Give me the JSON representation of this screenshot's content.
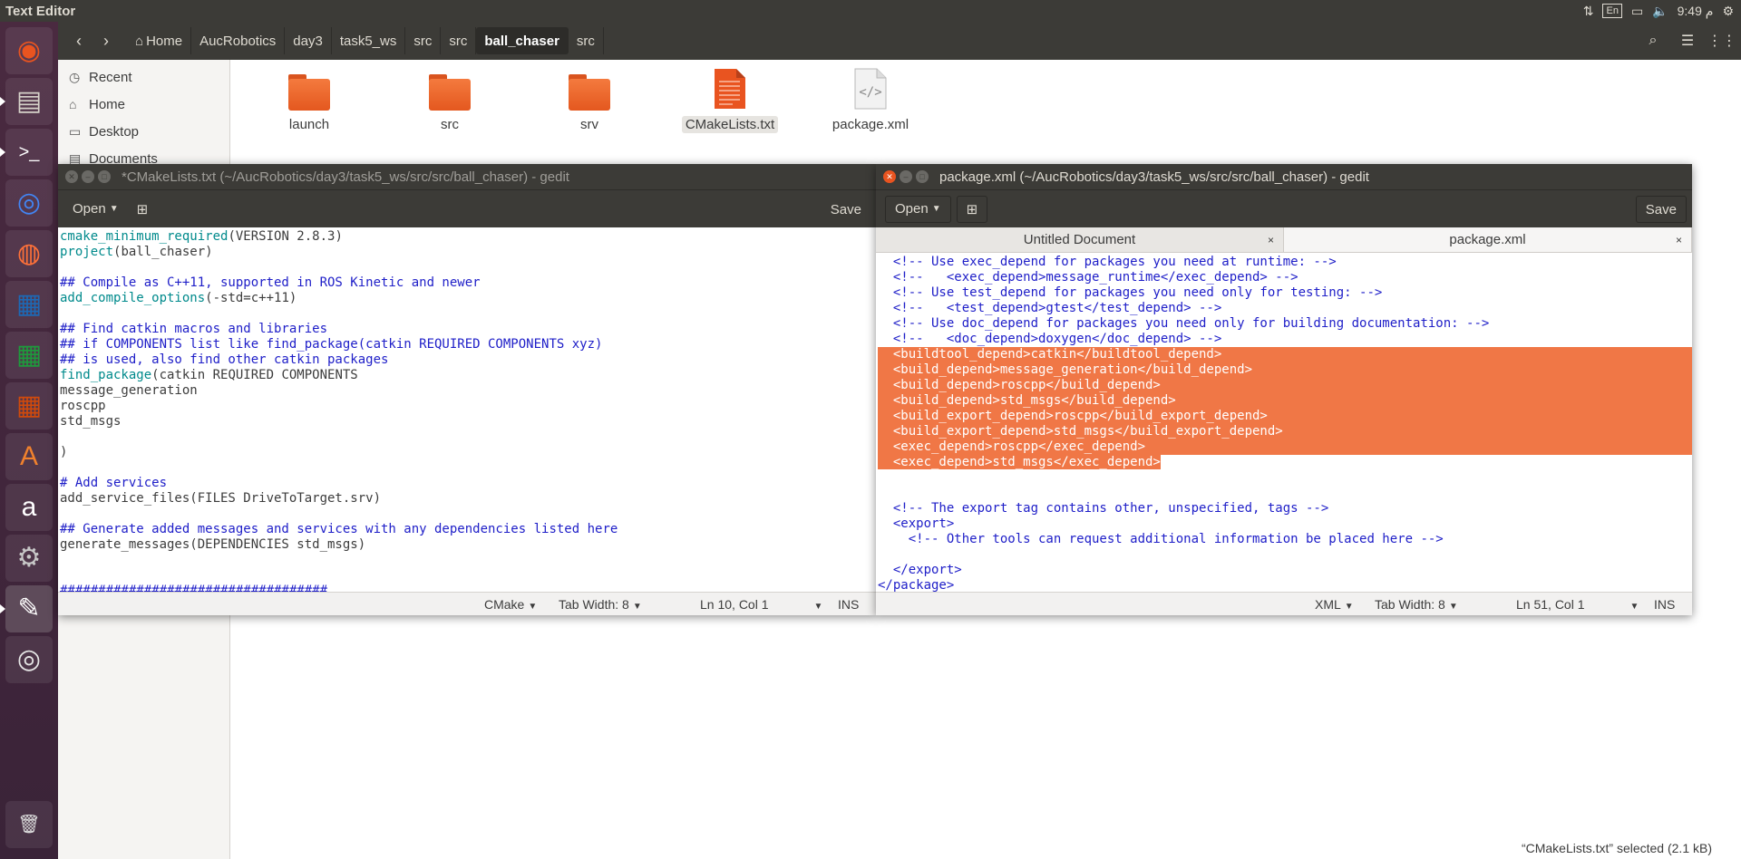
{
  "top_panel": {
    "app_title": "Text Editor",
    "keyboard_layout": "En",
    "clock": "9:49 م"
  },
  "launcher": {
    "items": [
      {
        "name": "ubuntu-logo-icon",
        "glyph": "◉",
        "color": "#e95420"
      },
      {
        "name": "files-icon",
        "glyph": "▤",
        "color": "#d6d2c9"
      },
      {
        "name": "terminal-icon",
        "glyph": ">_",
        "color": "#ffffff"
      },
      {
        "name": "chrome-icon",
        "glyph": "◎",
        "color": "#4285f4"
      },
      {
        "name": "firefox-icon",
        "glyph": "◍",
        "color": "#ff7139"
      },
      {
        "name": "writer-icon",
        "glyph": "▦",
        "color": "#1d69b5"
      },
      {
        "name": "calc-icon",
        "glyph": "▦",
        "color": "#1e9a3c"
      },
      {
        "name": "impress-icon",
        "glyph": "▦",
        "color": "#d04a0c"
      },
      {
        "name": "software-center-icon",
        "glyph": "A",
        "color": "#f0812d"
      },
      {
        "name": "amazon-icon",
        "glyph": "a",
        "color": "#ffffff"
      },
      {
        "name": "settings-icon",
        "glyph": "⚙",
        "color": "#c7c7c7"
      },
      {
        "name": "text-editor-icon",
        "glyph": "✎",
        "color": "#ffffff"
      },
      {
        "name": "dvd-icon",
        "glyph": "◎",
        "color": "#e6e6e6"
      },
      {
        "name": "trash-icon",
        "glyph": "🗑",
        "color": "#dddddd"
      }
    ]
  },
  "nautilus": {
    "breadcrumb": [
      {
        "label": "Home",
        "active": false
      },
      {
        "label": "AucRobotics",
        "active": false
      },
      {
        "label": "day3",
        "active": false
      },
      {
        "label": "task5_ws",
        "active": false
      },
      {
        "label": "src",
        "active": false
      },
      {
        "label": "src",
        "active": false
      },
      {
        "label": "ball_chaser",
        "active": true
      },
      {
        "label": "src",
        "active": false
      }
    ],
    "places": [
      "Recent",
      "Home",
      "Desktop",
      "Documents"
    ],
    "files": [
      {
        "label": "launch",
        "type": "folder",
        "selected": false
      },
      {
        "label": "src",
        "type": "folder",
        "selected": false
      },
      {
        "label": "srv",
        "type": "folder",
        "selected": false
      },
      {
        "label": "CMakeLists.txt",
        "type": "text",
        "selected": true
      },
      {
        "label": "package.xml",
        "type": "xml",
        "selected": false
      }
    ],
    "status": "“CMakeLists.txt” selected  (2.1 kB)"
  },
  "gedit_left": {
    "title": "*CMakeLists.txt (~/AucRobotics/day3/task5_ws/src/src/ball_chaser) - gedit",
    "open_label": "Open",
    "save_label": "Save",
    "lines": [
      [
        {
          "t": "cmake_minimum_required",
          "c": "kw"
        },
        {
          "t": "(VERSION 2.8.3)",
          "c": ""
        }
      ],
      [
        {
          "t": "project",
          "c": "kw"
        },
        {
          "t": "(ball_chaser)",
          "c": ""
        }
      ],
      [],
      [
        {
          "t": "## Compile as C++11, supported in ROS Kinetic and newer",
          "c": "cm"
        }
      ],
      [
        {
          "t": "add_compile_options",
          "c": "kw"
        },
        {
          "t": "(-std=c++11)",
          "c": ""
        }
      ],
      [],
      [
        {
          "t": "## Find catkin macros and libraries",
          "c": "cm"
        }
      ],
      [
        {
          "t": "## if COMPONENTS list like find_package(catkin REQUIRED COMPONENTS xyz)",
          "c": "cm"
        }
      ],
      [
        {
          "t": "## is used, also find other catkin packages",
          "c": "cm"
        }
      ],
      [
        {
          "t": "find_package",
          "c": "kw"
        },
        {
          "t": "(catkin REQUIRED COMPONENTS",
          "c": ""
        }
      ],
      [
        {
          "t": "message_generation",
          "c": ""
        }
      ],
      [
        {
          "t": "roscpp",
          "c": ""
        }
      ],
      [
        {
          "t": "std_msgs",
          "c": ""
        }
      ],
      [],
      [
        {
          "t": ")",
          "c": ""
        }
      ],
      [],
      [
        {
          "t": "# Add services",
          "c": "cm"
        }
      ],
      [
        {
          "t": "add_service_files(FILES DriveToTarget.srv)",
          "c": ""
        }
      ],
      [],
      [
        {
          "t": "## Generate added messages and services with any dependencies listed here",
          "c": "cm"
        }
      ],
      [
        {
          "t": "generate_messages(DEPENDENCIES std_msgs)",
          "c": ""
        }
      ],
      [],
      [],
      [
        {
          "t": "###################################",
          "c": "cm"
        }
      ]
    ],
    "status": {
      "language": "CMake",
      "tab_width": "Tab Width: 8",
      "position": "Ln 10, Col 1",
      "mode": "INS"
    }
  },
  "gedit_right": {
    "title": "package.xml (~/AucRobotics/day3/task5_ws/src/src/ball_chaser) - gedit",
    "open_label": "Open",
    "save_label": "Save",
    "tabs": [
      {
        "label": "Untitled Document",
        "active": false
      },
      {
        "label": "package.xml",
        "active": true
      }
    ],
    "lines": [
      [
        {
          "t": "  <!-- Use exec_depend for packages you need at runtime: -->",
          "c": "xml"
        }
      ],
      [
        {
          "t": "  <!--   <exec_depend>message_runtime</exec_depend> -->",
          "c": "xml"
        }
      ],
      [
        {
          "t": "  <!-- Use test_depend for packages you need only for testing: -->",
          "c": "xml"
        }
      ],
      [
        {
          "t": "  <!--   <test_depend>gtest</test_depend> -->",
          "c": "xml"
        }
      ],
      [
        {
          "t": "  <!-- Use doc_depend for packages you need only for building documentation: -->",
          "c": "xml"
        }
      ],
      [
        {
          "t": "  <!--   <doc_depend>doxygen</doc_depend> -->",
          "c": "xml"
        }
      ],
      [
        {
          "t": "  <buildtool_depend>catkin</buildtool_depend>",
          "c": "hl"
        }
      ],
      [
        {
          "t": "  <build_depend>message_generation</build_depend>",
          "c": "hl"
        }
      ],
      [
        {
          "t": "  <build_depend>roscpp</build_depend>",
          "c": "hl"
        }
      ],
      [
        {
          "t": "  <build_depend>std_msgs</build_depend>",
          "c": "hl"
        }
      ],
      [
        {
          "t": "  <build_export_depend>roscpp</build_export_depend>",
          "c": "hl"
        }
      ],
      [
        {
          "t": "  <build_export_depend>std_msgs</build_export_depend>",
          "c": "hl"
        }
      ],
      [
        {
          "t": "  <exec_depend>roscpp</exec_depend>",
          "c": "hl"
        }
      ],
      [
        {
          "t": "  <exec_depend>std_msgs</exec_depend>",
          "c": "hl-end"
        }
      ],
      [],
      [],
      [
        {
          "t": "  <!-- The export tag contains other, unspecified, tags -->",
          "c": "xml"
        }
      ],
      [
        {
          "t": "  <export>",
          "c": "xml"
        }
      ],
      [
        {
          "t": "    <!-- Other tools can request additional information be placed here -->",
          "c": "xml"
        }
      ],
      [],
      [
        {
          "t": "  </export>",
          "c": "xml"
        }
      ],
      [
        {
          "t": "</package>",
          "c": "xml"
        }
      ]
    ],
    "status": {
      "language": "XML",
      "tab_width": "Tab Width: 8",
      "position": "Ln 51, Col 1",
      "mode": "INS"
    }
  }
}
